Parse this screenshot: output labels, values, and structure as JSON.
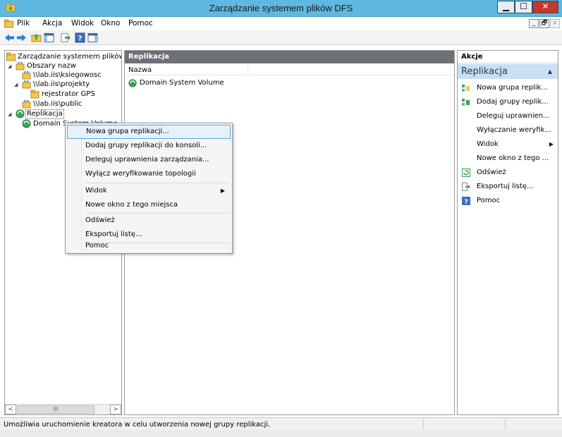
{
  "window": {
    "title": "Zarządzanie systemem plików DFS",
    "min_label": "▁",
    "max_label": "☐",
    "close_label": "✕"
  },
  "menubar": {
    "items": [
      "Plik",
      "Akcja",
      "Widok",
      "Okno",
      "Pomoc"
    ],
    "mdi_buttons": [
      "_",
      "🗗",
      "×"
    ]
  },
  "tree": {
    "root": "Zarządzanie systemem plików DFS",
    "namespaces": "Obszary nazw",
    "ns1": "\\\\lab.iis\\ksiegowosc",
    "ns2": "\\\\lab.iis\\projekty",
    "ns2_child": "rejestrator GPS",
    "ns3": "\\\\lab.iis\\public",
    "replication": "Replikacja",
    "replication_child": "Domain System Volume",
    "scroll_thumb": "III"
  },
  "middle": {
    "header": "Replikacja",
    "column_name": "Nazwa",
    "rows": [
      "Domain System Volume"
    ]
  },
  "actions": {
    "header": "Akcje",
    "section": "Replikacja",
    "items": [
      "Nowa grupa replik...",
      "Dodaj grupy replik...",
      "Deleguj uprawnien...",
      "Wyłączanie weryfik...",
      "Widok",
      "Nowe okno z tego ...",
      "Odśwież",
      "Eksportuj listę...",
      "Pomoc"
    ]
  },
  "context_menu": {
    "items": [
      "Nowa grupa replikacji...",
      "Dodaj grupy replikacji do konsoli...",
      "Deleguj uprawnienia zarządzania...",
      "Wyłącz weryfikowanie topologii",
      "Widok",
      "Nowe okno z tego miejsca",
      "Odśwież",
      "Eksportuj listę...",
      "Pomoc"
    ]
  },
  "status": {
    "text": "Umożliwia uruchomienie kreatora w celu utworzenia nowej grupy replikacji."
  },
  "icons": {
    "app": "dfs-management-icon",
    "back": "back-arrow-icon",
    "forward": "forward-arrow-icon",
    "up": "up-folder-icon",
    "show-hide-tree": "console-tree-icon",
    "export": "export-list-icon",
    "help": "help-icon",
    "show-hide-action": "action-pane-icon"
  },
  "colors": {
    "titlebar": "#5fb8e0",
    "close_button": "#c7372c",
    "pane_header": "#6d7176",
    "actions_section": "#c9dff2",
    "menu_highlight": "#e5f1fb"
  }
}
